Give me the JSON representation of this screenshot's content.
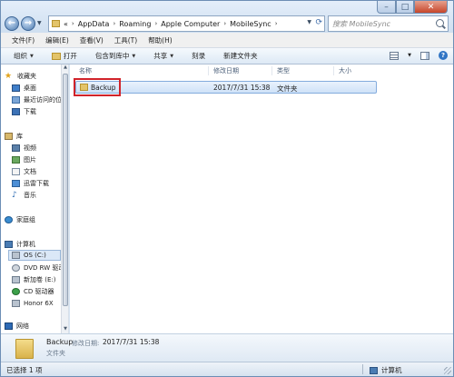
{
  "window": {
    "accent": "#d7e4f2",
    "highlight_box_color": "#d1232a"
  },
  "address": {
    "breadcrumbs": [
      "AppData",
      "Roaming",
      "Apple Computer",
      "MobileSync"
    ],
    "prefix": "«"
  },
  "search": {
    "placeholder": "搜索 MobileSync"
  },
  "menu": [
    "文件(F)",
    "编辑(E)",
    "查看(V)",
    "工具(T)",
    "帮助(H)"
  ],
  "toolbar": {
    "organize": "组织",
    "open": "打开",
    "include_library": "包含到库中",
    "share": "共享",
    "burn": "刻录",
    "new_folder": "新建文件夹"
  },
  "nav": {
    "favorites": "收藏夹",
    "desktop": "桌面",
    "recent": "最近访问的位置",
    "downloads": "下载",
    "libraries": "库",
    "videos": "视频",
    "pictures": "图片",
    "documents": "文档",
    "thunder_downloads": "迅雷下载",
    "music": "音乐",
    "homegroup": "家庭组",
    "computer": "计算机",
    "drive_c": "OS (C:)",
    "dvd": "DVD RW 驱动器",
    "new_volume": "新加卷 (E:)",
    "cd_drive": "CD 驱动器",
    "honor": "Honor 6X",
    "network": "网络"
  },
  "columns": {
    "name": "名称",
    "modified": "修改日期",
    "type": "类型",
    "size": "大小"
  },
  "files": [
    {
      "name": "Backup",
      "modified": "2017/7/31 15:38",
      "type": "文件夹",
      "size": ""
    }
  ],
  "details": {
    "name": "Backup",
    "modified_label": "修改日期:",
    "modified_value": "2017/7/31 15:38",
    "type": "文件夹"
  },
  "status": {
    "count": "已选择 1 项",
    "location": "计算机"
  }
}
